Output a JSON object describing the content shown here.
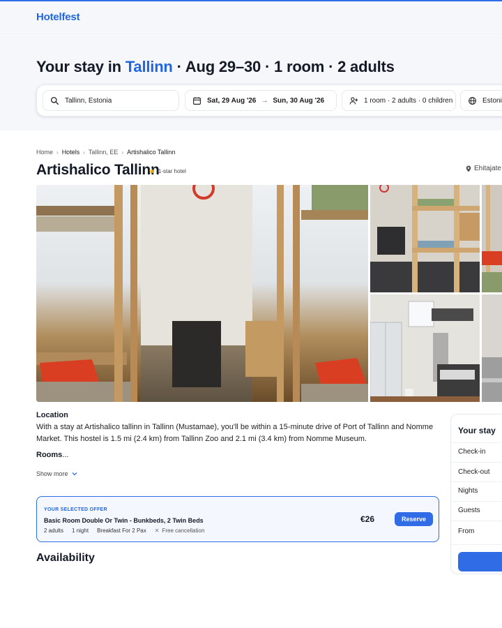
{
  "brand": {
    "logo_text": "Hotelfest",
    "accent": "#2f6ce6"
  },
  "hero": {
    "title_prefix": "Your stay in ",
    "title_city": "Tallinn",
    "title_suffix": " · Aug 29–30 · 1 room · 2 adults"
  },
  "search": {
    "destination": "Tallinn, Estonia",
    "checkin": "Sat, 29 Aug '26",
    "checkout": "Sun, 30 Aug '26",
    "guests": "1 room · 2 adults · 0 children",
    "language": "Estonia"
  },
  "breadcrumb": [
    "Home",
    "Hotels",
    "Tallinn, EE",
    "Artishalico Tallinn"
  ],
  "hotel": {
    "name": "Artishalico Tallinn",
    "rating_label": "1-star hotel",
    "address": "Ehitajate"
  },
  "location": {
    "heading": "Location",
    "text": "With a stay at Artishalico tallinn in Tallinn (Mustamae), you'll be within a 15-minute drive of Port of Tallinn and Nomme Market. This hostel is 1.5 mi (2.4 km) from Tallinn Zoo and 2.1 mi (3.4 km) from Nomme Museum."
  },
  "rooms": {
    "heading": "Rooms",
    "ellipsis": "..."
  },
  "show_more": "Show more",
  "offer": {
    "tag": "YOUR SELECTED OFFER",
    "room": "Basic Room Double Or Twin - Bunkbeds, 2 Twin Beds",
    "adults": "2 adults",
    "nights": "1 night",
    "board": "Breakfast For 2 Pax",
    "cancellation": "Free cancellation",
    "price": "€26",
    "reserve_label": "Reserve"
  },
  "availability_heading": "Availability",
  "stay_panel": {
    "title": "Your stay",
    "rows": [
      "Check-in",
      "Check-out",
      "Nights",
      "Guests",
      "From"
    ]
  }
}
